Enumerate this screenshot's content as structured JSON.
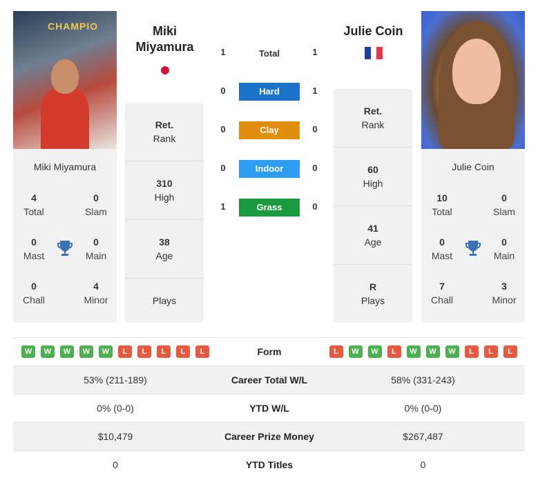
{
  "player1": {
    "name": "Miki Miyamura",
    "name_line1": "Miki",
    "name_line2": "Miyamura",
    "flag": "japan-flag",
    "photo_banner": "CHAMPIO",
    "stats": {
      "total": {
        "value": "4",
        "label": "Total"
      },
      "slam": {
        "value": "0",
        "label": "Slam"
      },
      "mast": {
        "value": "0",
        "label": "Mast"
      },
      "main": {
        "value": "0",
        "label": "Main"
      },
      "chall": {
        "value": "0",
        "label": "Chall"
      },
      "minor": {
        "value": "4",
        "label": "Minor"
      }
    },
    "rank": {
      "value": "Ret.",
      "label": "Rank"
    },
    "high": {
      "value": "310",
      "label": "High"
    },
    "age": {
      "value": "38",
      "label": "Age"
    },
    "plays": {
      "value": "",
      "label": "Plays"
    }
  },
  "player2": {
    "name": "Julie Coin",
    "flag": "france-flag",
    "stats": {
      "total": {
        "value": "10",
        "label": "Total"
      },
      "slam": {
        "value": "0",
        "label": "Slam"
      },
      "mast": {
        "value": "0",
        "label": "Mast"
      },
      "main": {
        "value": "0",
        "label": "Main"
      },
      "chall": {
        "value": "7",
        "label": "Chall"
      },
      "minor": {
        "value": "3",
        "label": "Minor"
      }
    },
    "rank": {
      "value": "Ret.",
      "label": "Rank"
    },
    "high": {
      "value": "60",
      "label": "High"
    },
    "age": {
      "value": "41",
      "label": "Age"
    },
    "plays": {
      "value": "R",
      "label": "Plays"
    }
  },
  "h2h": {
    "total": {
      "label": "Total",
      "p1": "1",
      "p2": "1"
    },
    "surfaces": [
      {
        "label": "Hard",
        "p1": "0",
        "p2": "1",
        "color": "#1a73c9"
      },
      {
        "label": "Clay",
        "p1": "0",
        "p2": "0",
        "color": "#e08e0b"
      },
      {
        "label": "Indoor",
        "p1": "0",
        "p2": "0",
        "color": "#2e9cf0"
      },
      {
        "label": "Grass",
        "p1": "1",
        "p2": "0",
        "color": "#1a9a3e"
      }
    ]
  },
  "comparison": {
    "form": {
      "label": "Form",
      "p1": [
        "W",
        "W",
        "W",
        "W",
        "W",
        "L",
        "L",
        "L",
        "L",
        "L"
      ],
      "p2": [
        "L",
        "W",
        "W",
        "L",
        "W",
        "W",
        "W",
        "L",
        "L",
        "L"
      ]
    },
    "rows": [
      {
        "label": "Career Total W/L",
        "p1": "53% (211-189)",
        "p2": "58% (331-243)"
      },
      {
        "label": "YTD W/L",
        "p1": "0% (0-0)",
        "p2": "0% (0-0)"
      },
      {
        "label": "Career Prize Money",
        "p1": "$10,479",
        "p2": "$267,487"
      },
      {
        "label": "YTD Titles",
        "p1": "0",
        "p2": "0"
      }
    ]
  },
  "colors": {
    "win": "#4caf50",
    "loss": "#e8593f",
    "trophy": "#3b6fb6"
  }
}
